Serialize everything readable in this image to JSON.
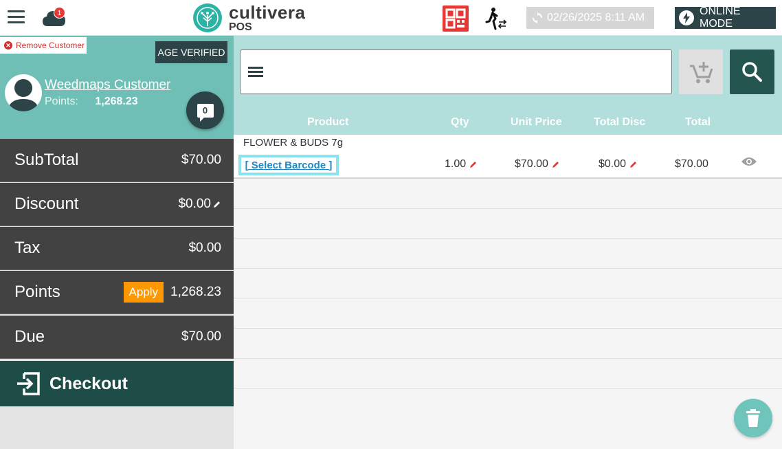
{
  "header": {
    "notification_count": "1",
    "logo_name": "cultivera",
    "logo_sub": "POS",
    "datetime": "02/26/2025 8:11 AM",
    "online_label": "ONLINE MODE"
  },
  "customer": {
    "remove_label": "Remove Customer",
    "age_verified": "AGE VERIFIED",
    "name": "Weedmaps Customer",
    "points_label": "Points:",
    "points_value": "1,268.23",
    "message_count": "0"
  },
  "summary": {
    "subtotal_label": "SubTotal",
    "subtotal_value": "$70.00",
    "discount_label": "Discount",
    "discount_value": "$0.00",
    "tax_label": "Tax",
    "tax_value": "$0.00",
    "points_label": "Points",
    "apply_label": "Apply",
    "points_value": "1,268.23",
    "due_label": "Due",
    "due_value": "$70.00",
    "checkout_label": "Checkout"
  },
  "table": {
    "headers": {
      "product": "Product",
      "qty": "Qty",
      "unit_price": "Unit Price",
      "total_disc": "Total Disc",
      "total": "Total"
    },
    "rows": [
      {
        "product": "FLOWER & BUDS 7g",
        "barcode_link": "[ Select Barcode ]",
        "qty": "1.00",
        "unit_price": "$70.00",
        "total_disc": "$0.00",
        "total": "$70.00"
      }
    ]
  }
}
